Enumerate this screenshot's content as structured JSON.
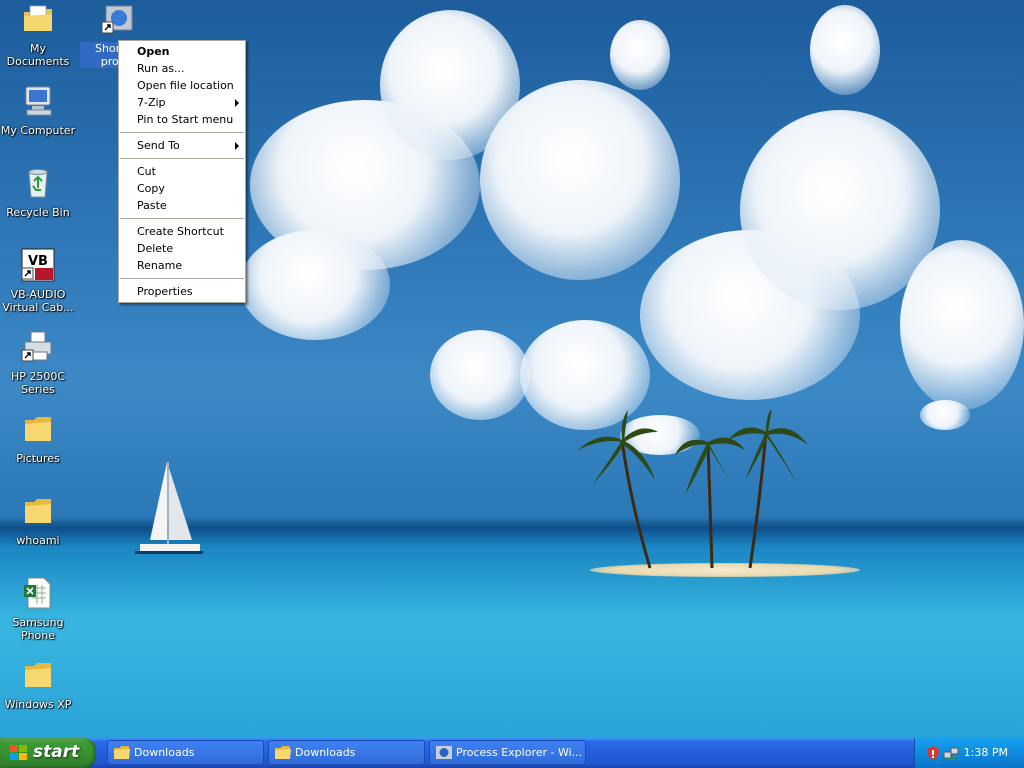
{
  "desktop_icons": [
    {
      "label": "My Documents"
    },
    {
      "label": "Shortc... proc..."
    },
    {
      "label": "My Computer"
    },
    {
      "label": "Recycle Bin"
    },
    {
      "label": "VB-AUDIO Virtual Cab..."
    },
    {
      "label": "HP 2500C Series"
    },
    {
      "label": "Pictures"
    },
    {
      "label": "whoami"
    },
    {
      "label": "Samsung Phone"
    },
    {
      "label": "Windows XP"
    }
  ],
  "context_menu": {
    "items": [
      "Open",
      "Run as...",
      "Open file location",
      "7-Zip",
      "Pin to Start menu",
      "Send To",
      "Cut",
      "Copy",
      "Paste",
      "Create Shortcut",
      "Delete",
      "Rename",
      "Properties"
    ]
  },
  "taskbar": {
    "start_label": "start",
    "tasks": [
      "Downloads",
      "Downloads",
      "Process Explorer - Wi..."
    ],
    "clock": "1:38 PM"
  },
  "colors": {
    "taskbar_blue": "#245edb",
    "start_green": "#3c9b35",
    "selection": "#316ac5"
  }
}
